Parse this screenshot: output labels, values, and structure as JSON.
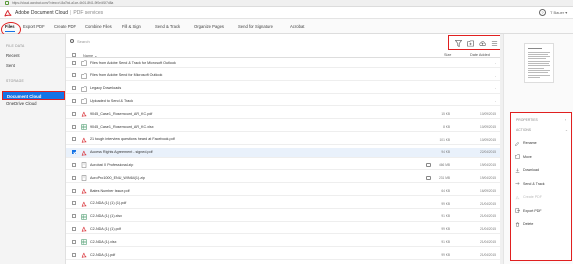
{
  "browser": {
    "url": "https://cloud.acrobat.com/?view=rl-8a7bd-a1ce-4b01-8f41-9f0e4f1f7d8a"
  },
  "app": {
    "title": "Adobe Document Cloud",
    "section": "PDF services",
    "help": "?",
    "user": "T Bauer ▾"
  },
  "tabs": [
    {
      "label": "Files",
      "active": true
    },
    {
      "label": "Export PDF"
    },
    {
      "label": "Create PDF"
    },
    {
      "label": "Combine Files"
    },
    {
      "label": "Fill & Sign"
    },
    {
      "label": "Send & Track"
    },
    {
      "label": "Organize Pages"
    },
    {
      "label": "Send for Signature"
    },
    {
      "label": "Acrobat"
    }
  ],
  "sidebar": {
    "files_heading": "FILE DATA",
    "recent": "Recent",
    "sent": "Sent",
    "storage_heading": "STORAGE",
    "document_cloud": "Document Cloud",
    "onedrive": "OneDrive Cloud"
  },
  "search": {
    "placeholder": "Search"
  },
  "toolbar": {
    "icons": [
      "filter-icon",
      "new-folder-icon",
      "upload-icon",
      "menu-icon"
    ]
  },
  "table": {
    "col_name": "Name ⌄",
    "col_size": "Size",
    "col_date": "Date Added",
    "rows": [
      {
        "name": "Files from Adobe Send & Track for Microsoft Outlook",
        "type": "folder",
        "size": "",
        "date": "-"
      },
      {
        "name": "Files from Adobe Send for Microsoft Outlook",
        "type": "folder",
        "size": "",
        "date": "-"
      },
      {
        "name": "Legacy Downloads",
        "type": "folder",
        "size": "",
        "date": "-"
      },
      {
        "name": "Uploaded to Send & Track",
        "type": "folder",
        "size": "",
        "date": "-"
      },
      {
        "name": "9045_Case1_Rosemount_AR_KC.pdf",
        "type": "pdf",
        "size": "15 KB",
        "date": "10/09/2015"
      },
      {
        "name": "9045_Case1_Rosemount_AR_KC.xlsx",
        "type": "xls",
        "size": "8 KB",
        "date": "10/09/2015"
      },
      {
        "name": "21 tough interview questions heard at Facebook.pdf",
        "type": "pdf",
        "size": "101 KB",
        "date": "10/09/2015"
      },
      {
        "name": "Access Rights Agreement - signed.pdf",
        "type": "pdf",
        "size": "94 KB",
        "date": "22/04/2015",
        "selected": true
      },
      {
        "name": "Acrobat X Professional.zip",
        "type": "zip",
        "size": "466 MB",
        "date": "19/04/2015",
        "shared": true
      },
      {
        "name": "AcroPro1000_ENU_WIN64(1).zip",
        "type": "zip",
        "size": "231 MB",
        "date": "19/04/2015",
        "shared": true
      },
      {
        "name": "Bates Number Issue.pdf",
        "type": "pdf",
        "size": "64 KB",
        "date": "16/09/2015"
      },
      {
        "name": "C2-NDA (1) (1) (1).pdf",
        "type": "pdf",
        "size": "99 KB",
        "date": "21/04/2015"
      },
      {
        "name": "C2-NDA (1) (1).xlsx",
        "type": "xls",
        "size": "91 KB",
        "date": "21/04/2015"
      },
      {
        "name": "C2-NDA (1) (1).pdf",
        "type": "pdf",
        "size": "99 KB",
        "date": "21/04/2015"
      },
      {
        "name": "C2-NDA (1).xlsx",
        "type": "xls",
        "size": "91 KB",
        "date": "21/04/2015"
      },
      {
        "name": "C2-NDA (1).pdf",
        "type": "pdf",
        "size": "99 KB",
        "date": "21/04/2015"
      }
    ]
  },
  "panel": {
    "properties": "PROPERTIES",
    "actions": "ACTIONS",
    "items": [
      {
        "label": "Rename",
        "icon": "rename-icon"
      },
      {
        "label": "Move",
        "icon": "move-icon"
      },
      {
        "label": "Download",
        "icon": "download-icon"
      },
      {
        "label": "Send & Track",
        "icon": "send-icon"
      },
      {
        "label": "Create PDF",
        "icon": "create-pdf-icon",
        "disabled": true
      },
      {
        "label": "Export PDF",
        "icon": "export-pdf-icon"
      },
      {
        "label": "Delete",
        "icon": "delete-icon"
      }
    ]
  },
  "colors": {
    "accent": "#1473e6",
    "highlight": "#e02020",
    "pdf_red": "#d7282f",
    "xls_green": "#2e8b57"
  }
}
